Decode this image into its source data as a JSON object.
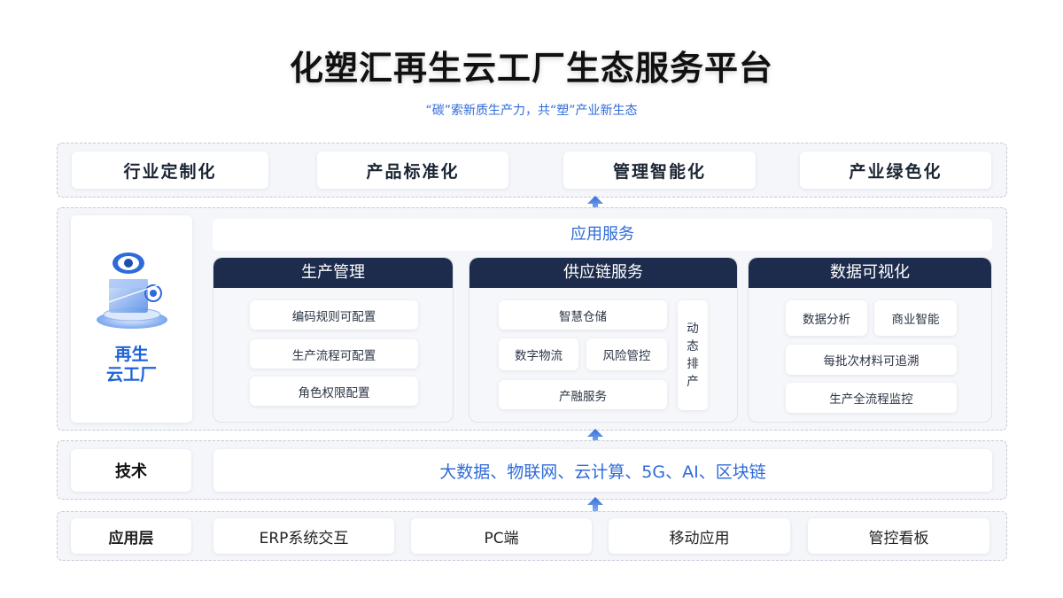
{
  "title": "化塑汇再生云工厂生态服务平台",
  "subtitle": "“碳”索新质生产力，共“塑”产业新生态",
  "goals": [
    "行业定制化",
    "产品标准化",
    "管理智能化",
    "产业绿色化"
  ],
  "factory": {
    "label_line1": "再生",
    "label_line2": "云工厂"
  },
  "app_service": {
    "title": "应用服务",
    "production": {
      "title": "生产管理",
      "items": [
        "编码规则可配置",
        "生产流程可配置",
        "角色权限配置"
      ]
    },
    "supply_chain": {
      "title": "供应链服务",
      "items": [
        "智慧仓储",
        "数字物流",
        "风险管控",
        "产融服务"
      ],
      "vertical": [
        "动",
        "态",
        "排",
        "产"
      ]
    },
    "data_viz": {
      "title": "数据可视化",
      "items": [
        "数据分析",
        "商业智能",
        "每批次材料可追溯",
        "生产全流程监控"
      ]
    }
  },
  "tech": {
    "label": "技术",
    "content": "大数据、物联网、云计算、5G、AI、区块链"
  },
  "app_layer": {
    "label": "应用层",
    "items": [
      "ERP系统交互",
      "PC端",
      "移动应用",
      "管控看板"
    ]
  },
  "colors": {
    "accent_blue": "#2f6bd8",
    "header_navy": "#1d2c4c"
  },
  "icons": {
    "factory": "eye-cube-platform-icon",
    "arrow": "arrow-up-icon"
  }
}
